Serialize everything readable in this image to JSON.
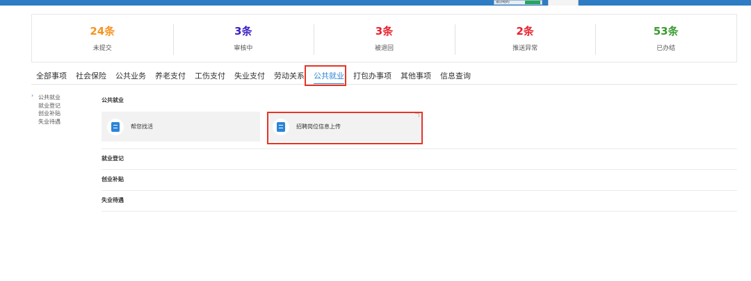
{
  "topbar": {
    "control_label": "按办结时"
  },
  "stats": [
    {
      "count": "24条",
      "label": "未提交",
      "color": "#f7931e"
    },
    {
      "count": "3条",
      "label": "审核中",
      "color": "#3a1fc4"
    },
    {
      "count": "3条",
      "label": "被退回",
      "color": "#e8202e"
    },
    {
      "count": "2条",
      "label": "推送异常",
      "color": "#e8202e"
    },
    {
      "count": "53条",
      "label": "已办结",
      "color": "#3a9a2f"
    }
  ],
  "tabs": [
    {
      "label": "全部事项"
    },
    {
      "label": "社会保险"
    },
    {
      "label": "公共业务"
    },
    {
      "label": "养老支付"
    },
    {
      "label": "工伤支付"
    },
    {
      "label": "失业支付"
    },
    {
      "label": "劳动关系"
    },
    {
      "label": "公共就业",
      "active": true
    },
    {
      "label": "打包办事项"
    },
    {
      "label": "其他事项"
    },
    {
      "label": "信息查询"
    }
  ],
  "sidebar": {
    "items": [
      "公共就业",
      "就业登记",
      "创业补贴",
      "失业待遇"
    ]
  },
  "sections": {
    "public_employment": "公共就业",
    "employment_registration": "就业登记",
    "startup_subsidy": "创业补贴",
    "unemployment_benefits": "失业待遇"
  },
  "cards": [
    {
      "label": "帮您找活",
      "icon": "document-icon"
    },
    {
      "label": "招聘岗位信息上传",
      "icon": "document-icon"
    }
  ],
  "colors": {
    "accent": "#2c84d8",
    "highlight": "#e53424",
    "topbar": "#2e7cc4"
  }
}
